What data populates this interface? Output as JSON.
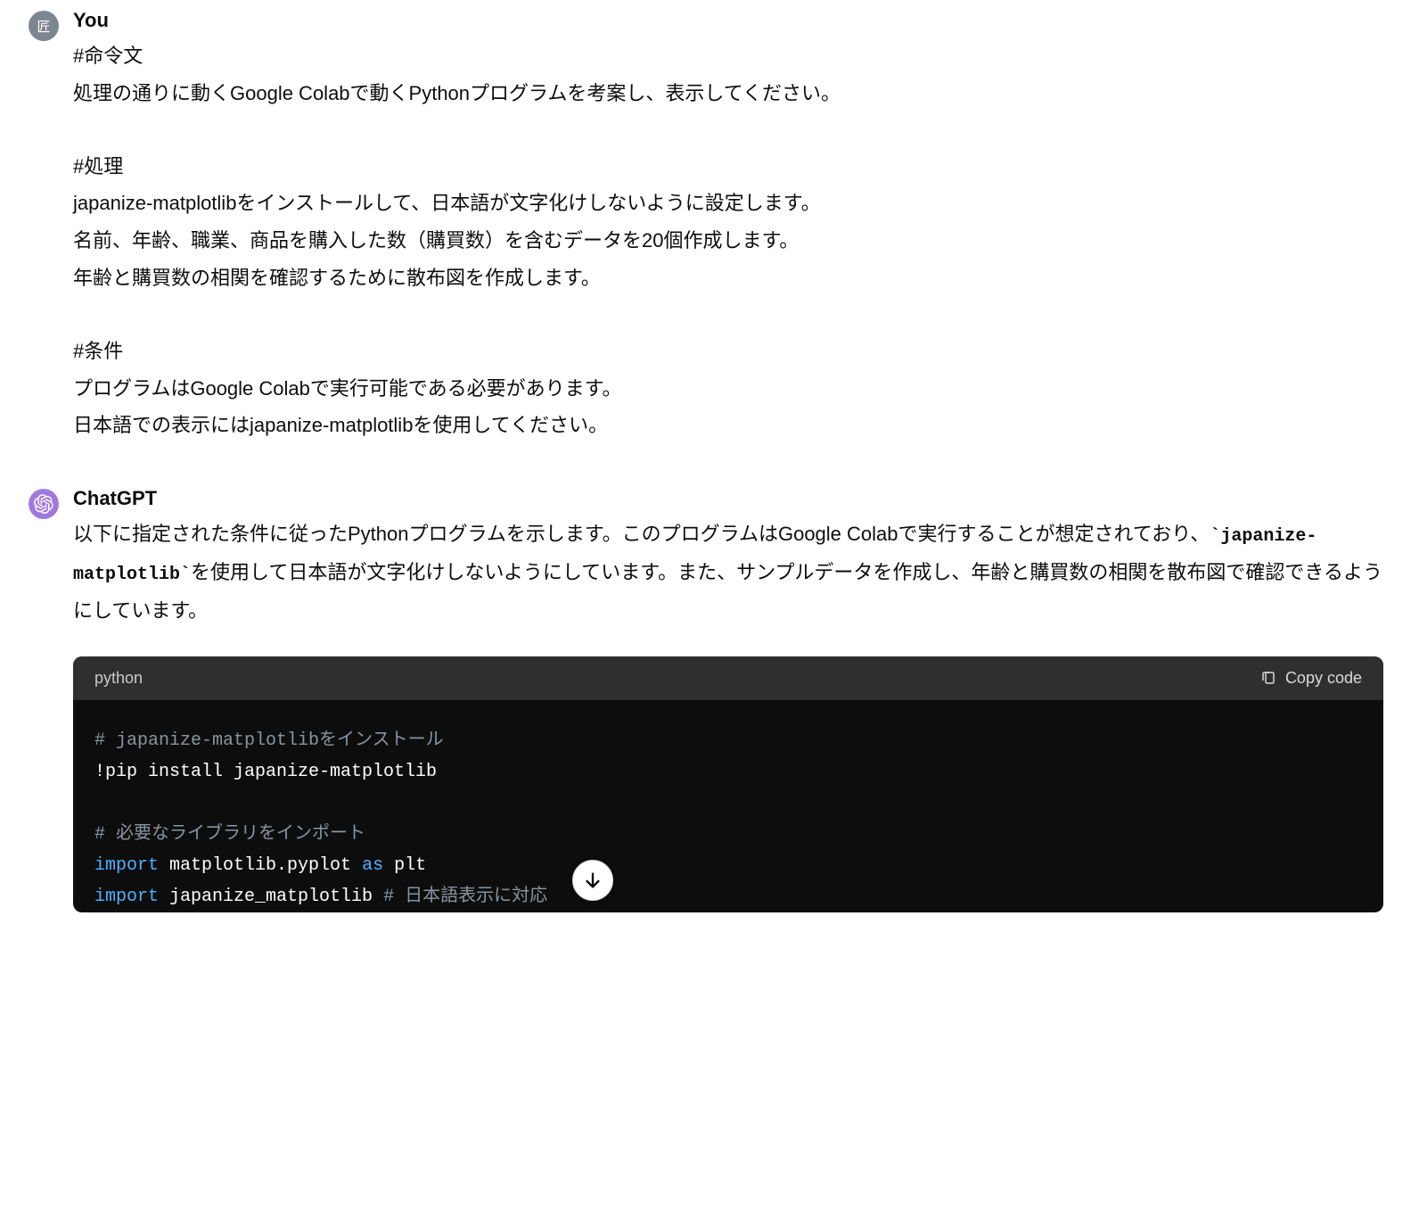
{
  "user": {
    "name_label": "You",
    "avatar_glyph": "匠",
    "content": {
      "p1": {
        "l1": "#命令文",
        "l2": "処理の通りに動くGoogle Colabで動くPythonプログラムを考案し、表示してください。"
      },
      "p2": {
        "l1": "#処理",
        "l2": "japanize-matplotlibをインストールして、日本語が文字化けしないように設定します。",
        "l3": "名前、年齢、職業、商品を購入した数（購買数）を含むデータを20個作成します。",
        "l4": "年齢と購買数の相関を確認するために散布図を作成します。"
      },
      "p3": {
        "l1": "#条件",
        "l2": "プログラムはGoogle Colabで実行可能である必要があります。",
        "l3": "日本語での表示にはjapanize-matplotlibを使用してください。"
      }
    }
  },
  "assistant": {
    "name_label": "ChatGPT",
    "content": {
      "intro_pre": "以下に指定された条件に従ったPythonプログラムを示します。このプログラムはGoogle Colabで実行することが想定されており、",
      "intro_code": "`japanize-matplotlib`",
      "intro_post": "を使用して日本語が文字化けしないようにしています。また、サンプルデータを作成し、年齢と購買数の相関を散布図で確認できるようにしています。"
    },
    "code": {
      "language_label": "python",
      "copy_label": "Copy code",
      "lines": {
        "c1": "# japanize-matplotlibをインストール",
        "l1": "!pip install japanize-matplotlib",
        "blank1": "",
        "c2": "# 必要なライブラリをインポート",
        "l2_kw": "import",
        "l2_rest": " matplotlib.pyplot ",
        "l2_as": "as",
        "l2_alias": " plt",
        "l3_kw": "import",
        "l3_rest": " japanize_matplotlib ",
        "l3_comment": "# 日本語表示に対応"
      }
    }
  },
  "scroll_button_label": "↓"
}
